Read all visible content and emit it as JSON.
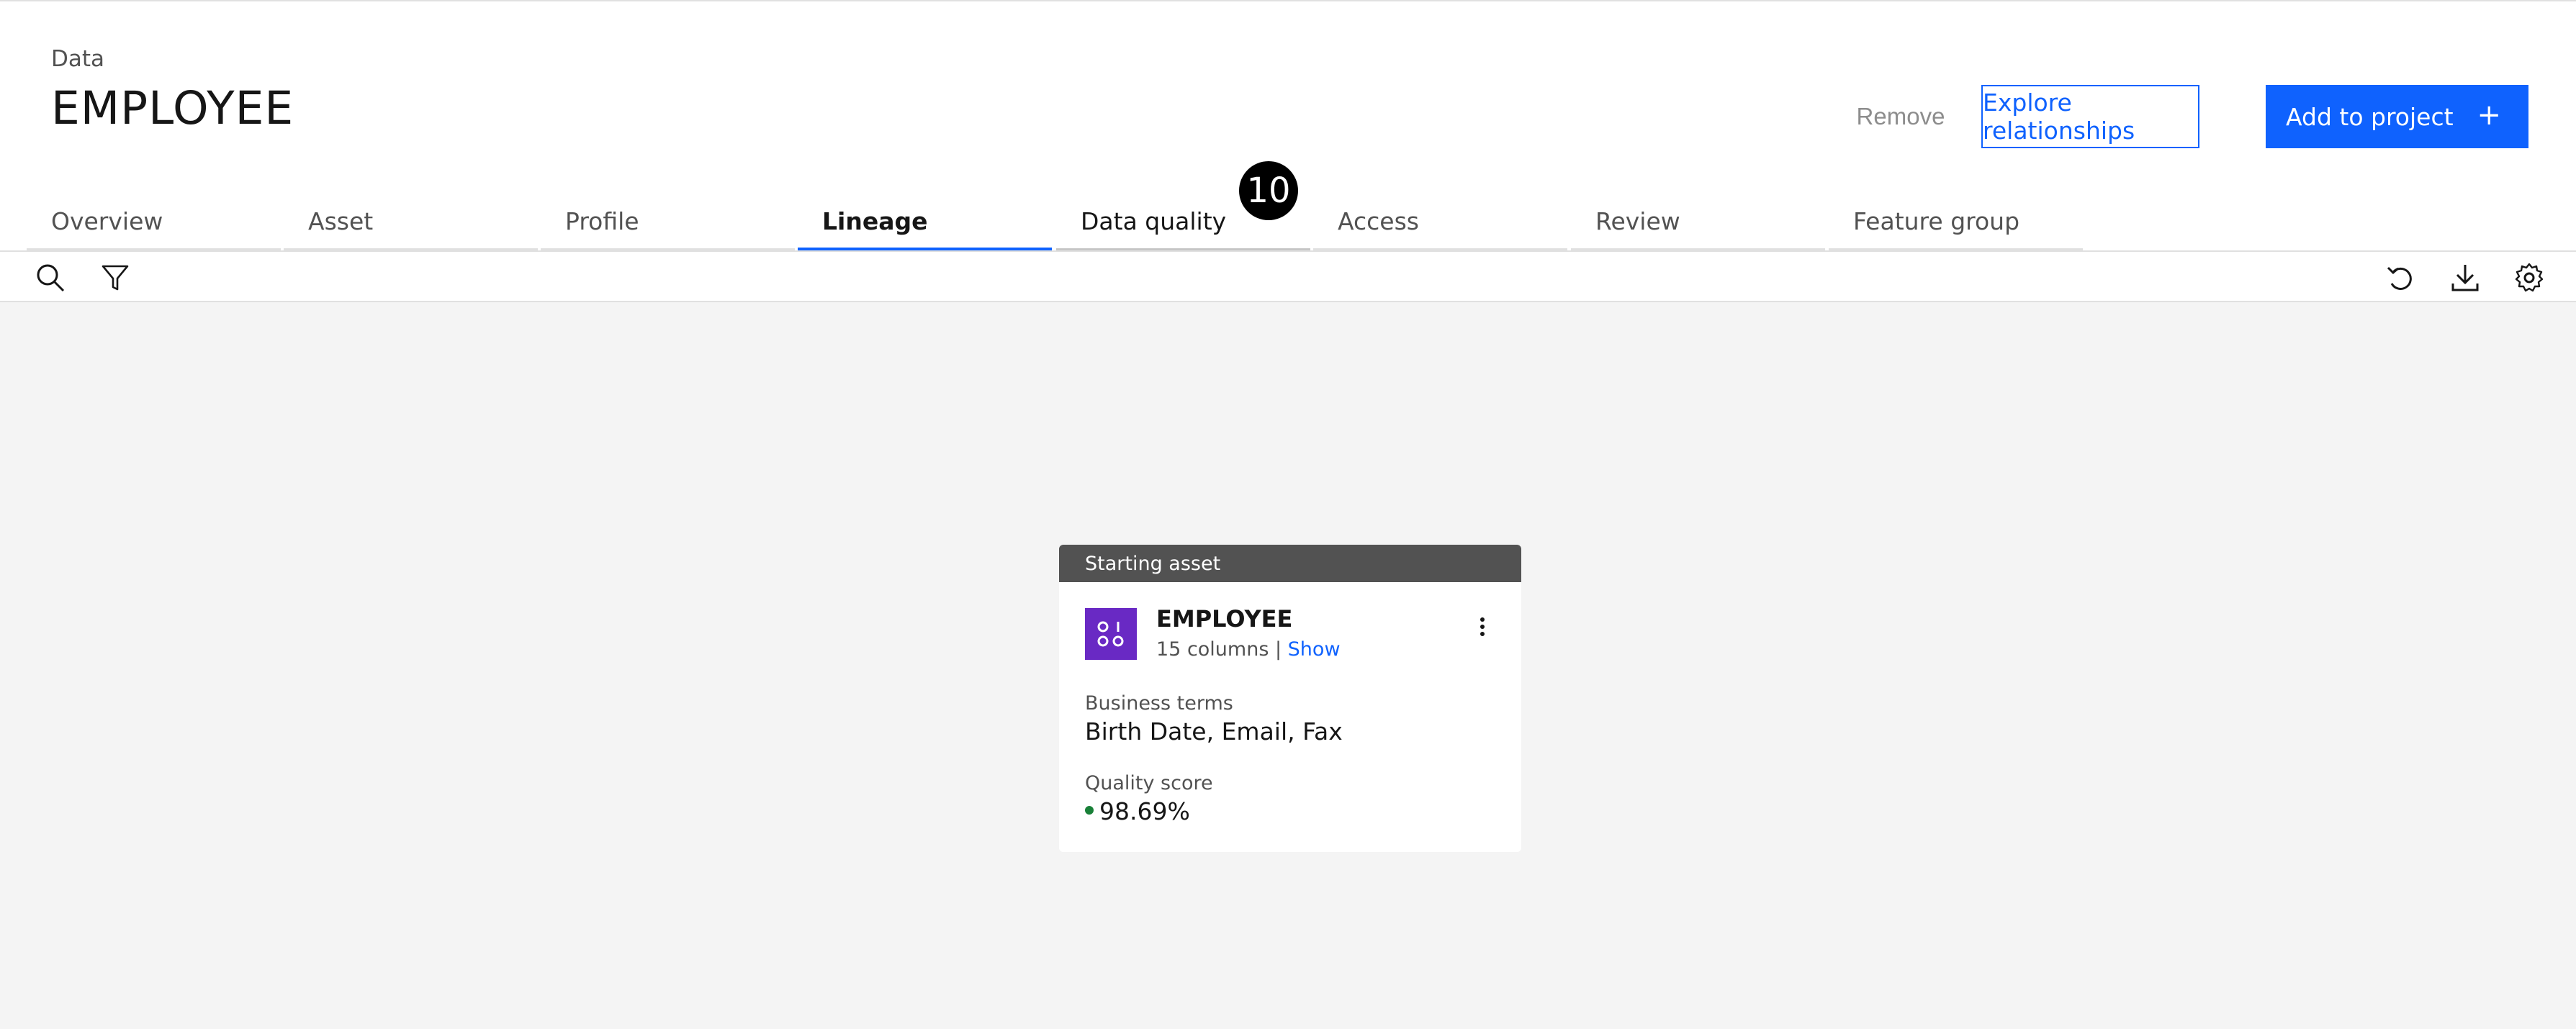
{
  "header": {
    "breadcrumb": "Data",
    "title": "EMPLOYEE",
    "remove_label": "Remove",
    "explore_label": "Explore relationships",
    "add_label": "Add to project",
    "add_icon": "+"
  },
  "tabs": [
    {
      "label": "Overview"
    },
    {
      "label": "Asset"
    },
    {
      "label": "Profile"
    },
    {
      "label": "Lineage"
    },
    {
      "label": "Data quality"
    },
    {
      "label": "Access"
    },
    {
      "label": "Review"
    },
    {
      "label": "Feature group"
    }
  ],
  "active_tab": "Lineage",
  "badge": "10",
  "toolbar": {
    "left_icons": [
      "search-icon",
      "filter-icon"
    ],
    "right_icons": [
      "reset-icon",
      "download-icon",
      "settings-icon"
    ]
  },
  "card": {
    "header": "Starting asset",
    "asset_name": "EMPLOYEE",
    "columns_text": "15 columns |",
    "show_link": "Show",
    "business_terms_label": "Business terms",
    "business_terms_value": "Birth Date, Email, Fax",
    "quality_label": "Quality score",
    "quality_value": "98.69%",
    "quality_status_color": "#198038",
    "asset_icon": "data-table-icon",
    "asset_icon_color": "#6929c4"
  },
  "colors": {
    "primary": "#0f62fe",
    "header_bg": "#ffffff",
    "canvas_bg": "#f4f4f4"
  }
}
